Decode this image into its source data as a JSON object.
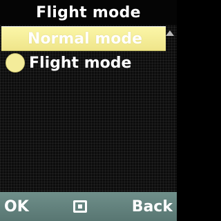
{
  "header": {
    "title": "Flight mode"
  },
  "menu": {
    "items": [
      {
        "label": "Normal mode",
        "selected": true
      },
      {
        "label": "Flight mode",
        "selected": false
      }
    ]
  },
  "softkeys": {
    "left": "OK",
    "center_icon": "select-icon",
    "right": "Back"
  },
  "colors": {
    "highlight": "#f4ec9a",
    "softkey_bar": "#6f8f8a",
    "background": "#0c0c0c"
  }
}
